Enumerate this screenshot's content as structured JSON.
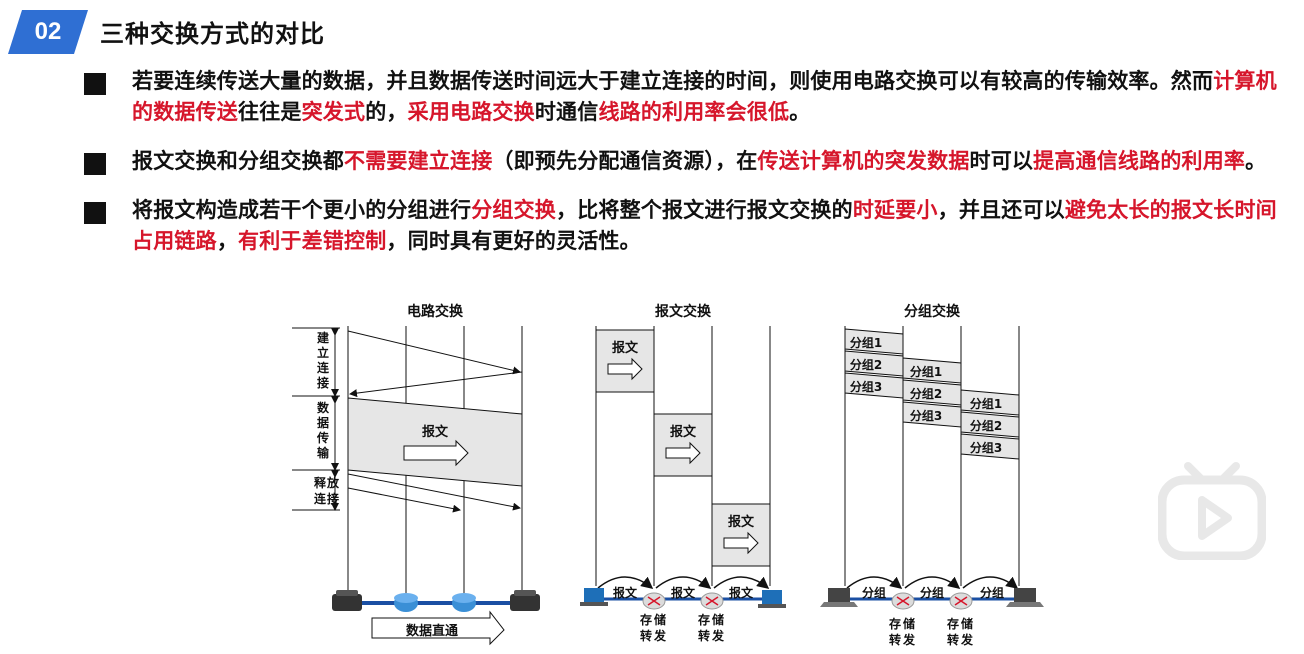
{
  "header": {
    "badge": "02",
    "title": "三种交换方式的对比"
  },
  "bullets": [
    {
      "segments": [
        {
          "text": "若要连续传送大量的数据，并且数据传送时间远大于建立连接的时间，则使用电路交换可以有较高的传输效率。然而",
          "red": false
        },
        {
          "text": "计算机的数据传送",
          "red": true
        },
        {
          "text": "往往是",
          "red": false
        },
        {
          "text": "突发式",
          "red": true
        },
        {
          "text": "的，",
          "red": false
        },
        {
          "text": "采用电路交换",
          "red": true
        },
        {
          "text": "时通信",
          "red": false
        },
        {
          "text": "线路的利用率会很低",
          "red": true
        },
        {
          "text": "。",
          "red": false
        }
      ]
    },
    {
      "segments": [
        {
          "text": "报文交换和分组交换都",
          "red": false
        },
        {
          "text": "不需要建立连接",
          "red": true
        },
        {
          "text": "（即预先分配通信资源），在",
          "red": false
        },
        {
          "text": "传送计算机的突发数据",
          "red": true
        },
        {
          "text": "时可以",
          "red": false
        },
        {
          "text": "提高通信线路的利用率",
          "red": true
        },
        {
          "text": "。",
          "red": false
        }
      ]
    },
    {
      "segments": [
        {
          "text": "将报文构造成若干个更小的分组进行",
          "red": false
        },
        {
          "text": "分组交换",
          "red": true
        },
        {
          "text": "，比将整个报文进行报文交换的",
          "red": false
        },
        {
          "text": "时延要小",
          "red": true
        },
        {
          "text": "，并且还可以",
          "red": false
        },
        {
          "text": "避免太长的报文长时间占用链路",
          "red": true
        },
        {
          "text": "，",
          "red": false
        },
        {
          "text": "有利于差错控制",
          "red": true
        },
        {
          "text": "，同时具有更好的灵活性。",
          "red": false
        }
      ]
    }
  ],
  "diagram": {
    "circuit": {
      "title": "电路交换",
      "phase_setup": "建立连接",
      "phase_transfer": "数据传输",
      "phase_release": "释放连接",
      "message": "报文",
      "direct": "数据直通"
    },
    "message_switching": {
      "title": "报文交换",
      "message": "报文",
      "store_forward": "存储转发"
    },
    "packet_switching": {
      "title": "分组交换",
      "packets": [
        "分组1",
        "分组2",
        "分组3"
      ],
      "packet": "分组",
      "store_forward": "存储转发"
    }
  },
  "colors": {
    "badge": "#2f6fd3",
    "accent_red": "#d6162b",
    "router": "#3a8fd6"
  }
}
